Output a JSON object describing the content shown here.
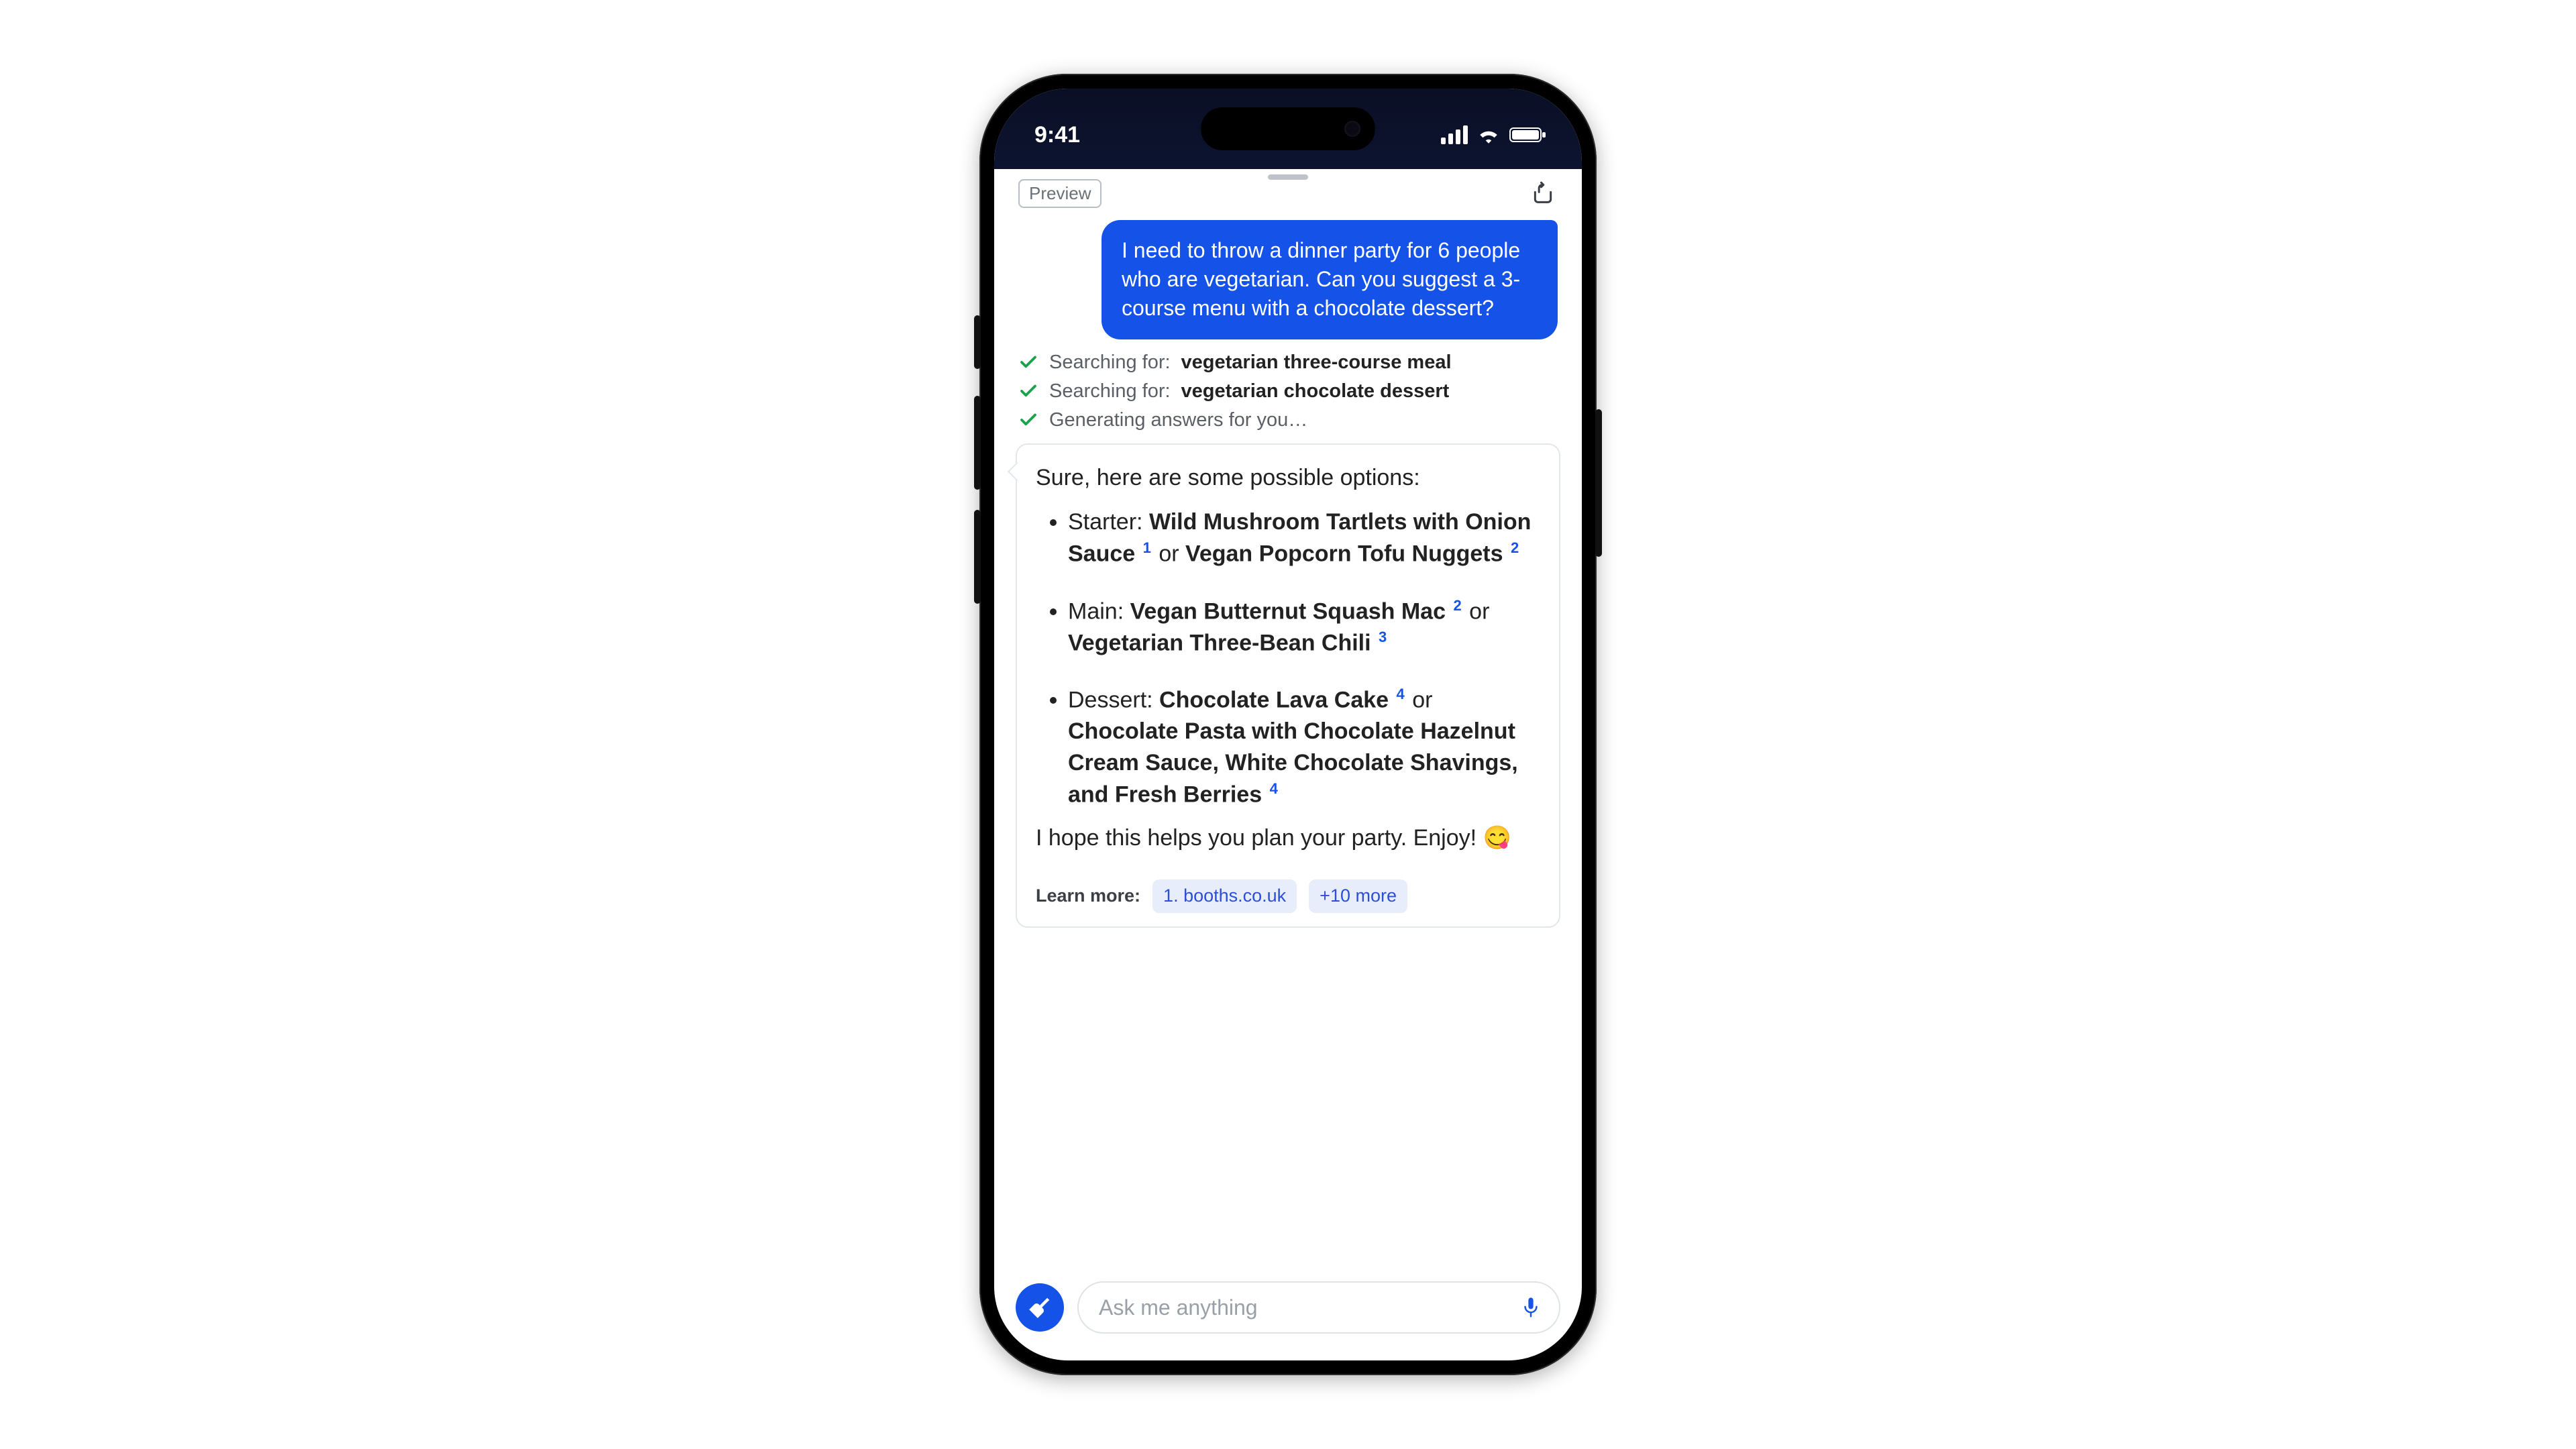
{
  "status": {
    "time": "9:41"
  },
  "topbar": {
    "preview": "Preview"
  },
  "user_message": "I need to throw a dinner party for 6 people who are vegetarian. Can you suggest a 3-course menu with a chocolate dessert?",
  "steps": [
    {
      "prefix": "Searching for:",
      "term": "vegetarian three-course meal"
    },
    {
      "prefix": "Searching for:",
      "term": "vegetarian chocolate dessert"
    },
    {
      "prefix": "Generating answers for you…",
      "term": ""
    }
  ],
  "answer": {
    "intro": "Sure, here are some possible options:",
    "items": [
      {
        "label": "Starter:",
        "opt1": "Wild Mushroom Tartlets with Onion Sauce",
        "ref1": "1",
        "conj": "or",
        "opt2": "Vegan Popcorn Tofu Nuggets",
        "ref2": "2"
      },
      {
        "label": "Main:",
        "opt1": "Vegan Butternut Squash Mac",
        "ref1": "2",
        "conj": "or",
        "opt2": "Vegetarian Three-Bean Chili",
        "ref2": "3"
      },
      {
        "label": "Dessert:",
        "opt1": "Chocolate Lava Cake",
        "ref1": "4",
        "conj": "or",
        "opt2": "Chocolate Pasta with Chocolate Hazelnut Cream Sauce, White Chocolate Shavings, and Fresh Berries",
        "ref2": "4"
      }
    ],
    "closing": "I hope this helps you plan your party. Enjoy! 😋"
  },
  "learn_more": {
    "label": "Learn more:",
    "chips": [
      "1. booths.co.uk",
      "+10 more"
    ]
  },
  "input": {
    "placeholder": "Ask me anything"
  }
}
